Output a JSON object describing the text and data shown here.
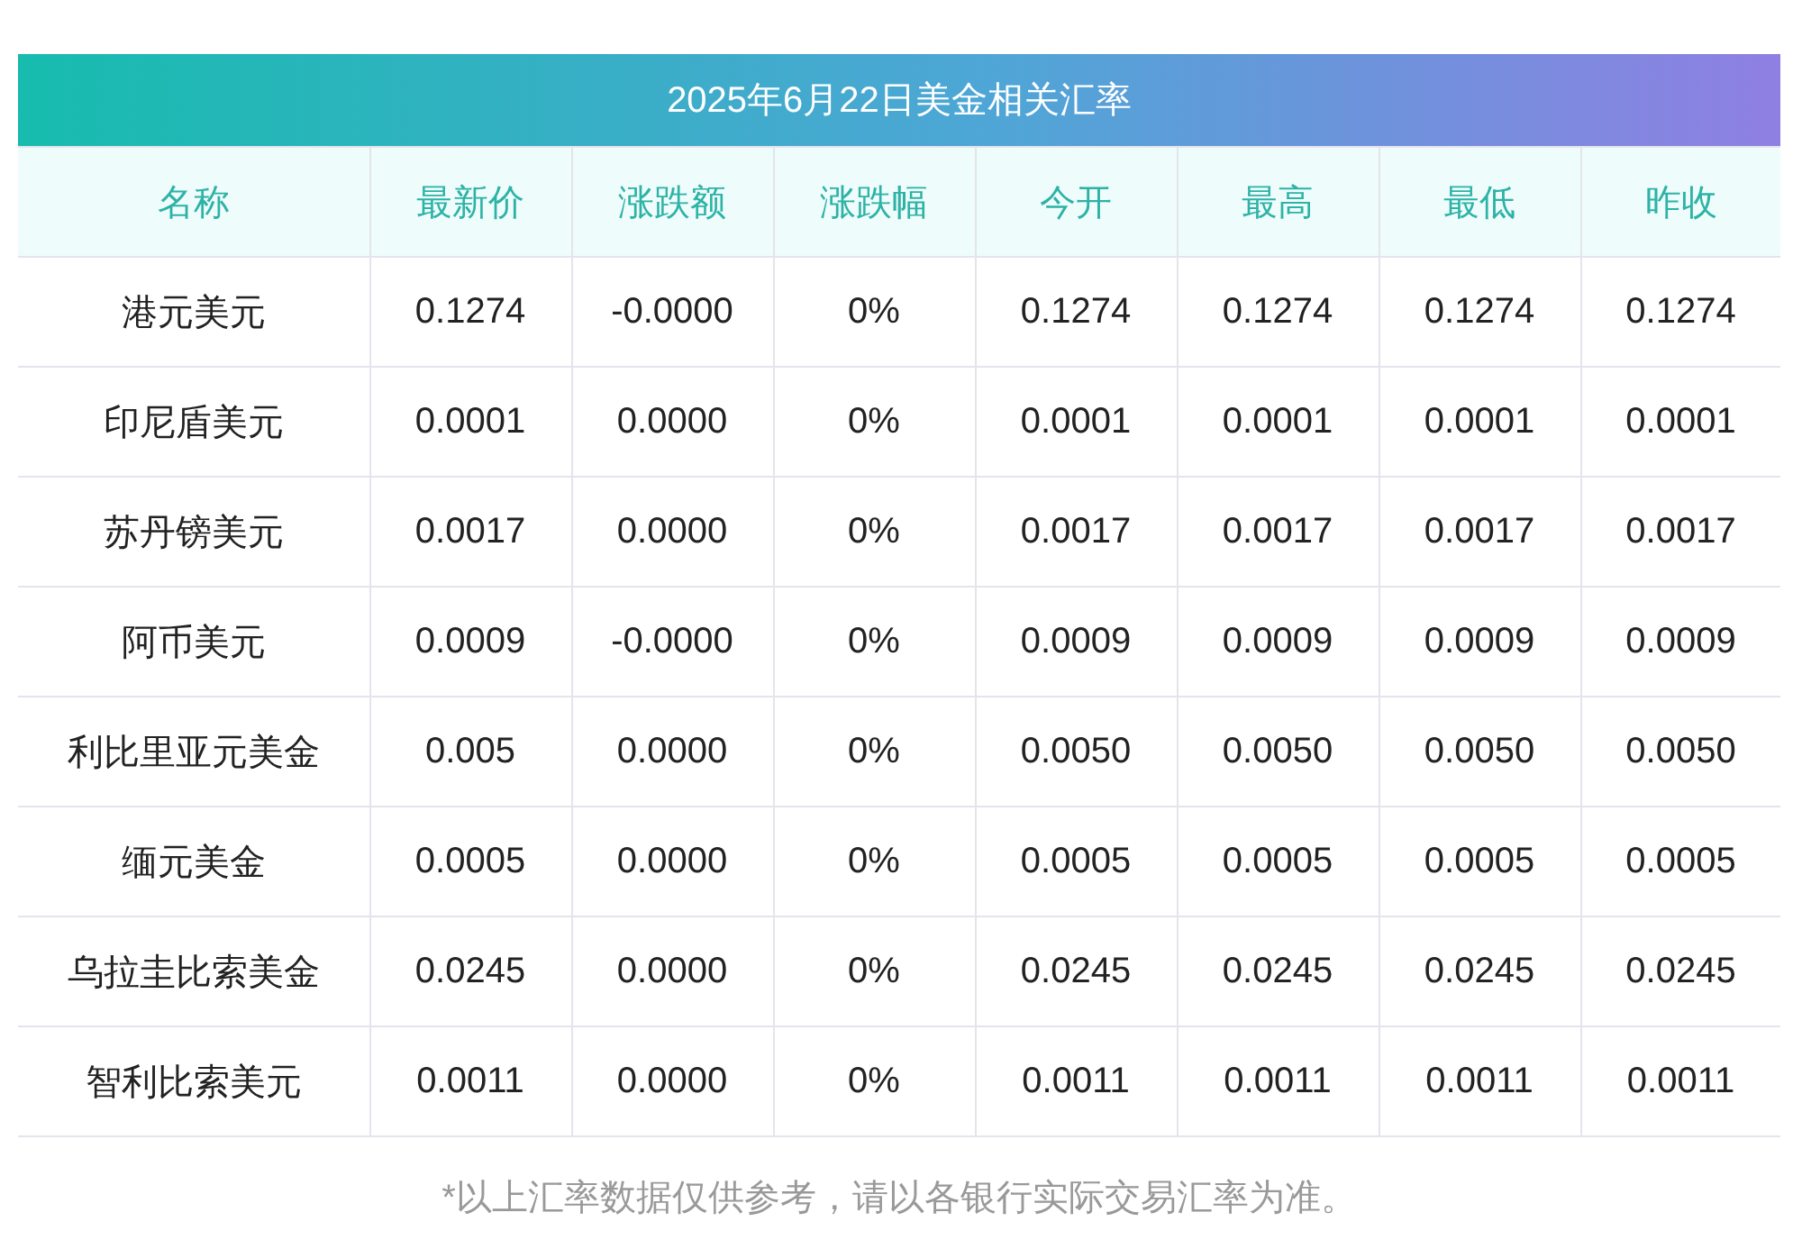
{
  "title": "2025年6月22日美金相关汇率",
  "columns": [
    "名称",
    "最新价",
    "涨跌额",
    "涨跌幅",
    "今开",
    "最高",
    "最低",
    "昨收"
  ],
  "rows": [
    [
      "港元美元",
      "0.1274",
      "-0.0000",
      "0%",
      "0.1274",
      "0.1274",
      "0.1274",
      "0.1274"
    ],
    [
      "印尼盾美元",
      "0.0001",
      "0.0000",
      "0%",
      "0.0001",
      "0.0001",
      "0.0001",
      "0.0001"
    ],
    [
      "苏丹镑美元",
      "0.0017",
      "0.0000",
      "0%",
      "0.0017",
      "0.0017",
      "0.0017",
      "0.0017"
    ],
    [
      "阿币美元",
      "0.0009",
      "-0.0000",
      "0%",
      "0.0009",
      "0.0009",
      "0.0009",
      "0.0009"
    ],
    [
      "利比里亚元美金",
      "0.005",
      "0.0000",
      "0%",
      "0.0050",
      "0.0050",
      "0.0050",
      "0.0050"
    ],
    [
      "缅元美金",
      "0.0005",
      "0.0000",
      "0%",
      "0.0005",
      "0.0005",
      "0.0005",
      "0.0005"
    ],
    [
      "乌拉圭比索美金",
      "0.0245",
      "0.0000",
      "0%",
      "0.0245",
      "0.0245",
      "0.0245",
      "0.0245"
    ],
    [
      "智利比索美元",
      "0.0011",
      "0.0000",
      "0%",
      "0.0011",
      "0.0011",
      "0.0011",
      "0.0011"
    ]
  ],
  "footnote": "*以上汇率数据仅供参考，请以各银行实际交易汇率为准。"
}
